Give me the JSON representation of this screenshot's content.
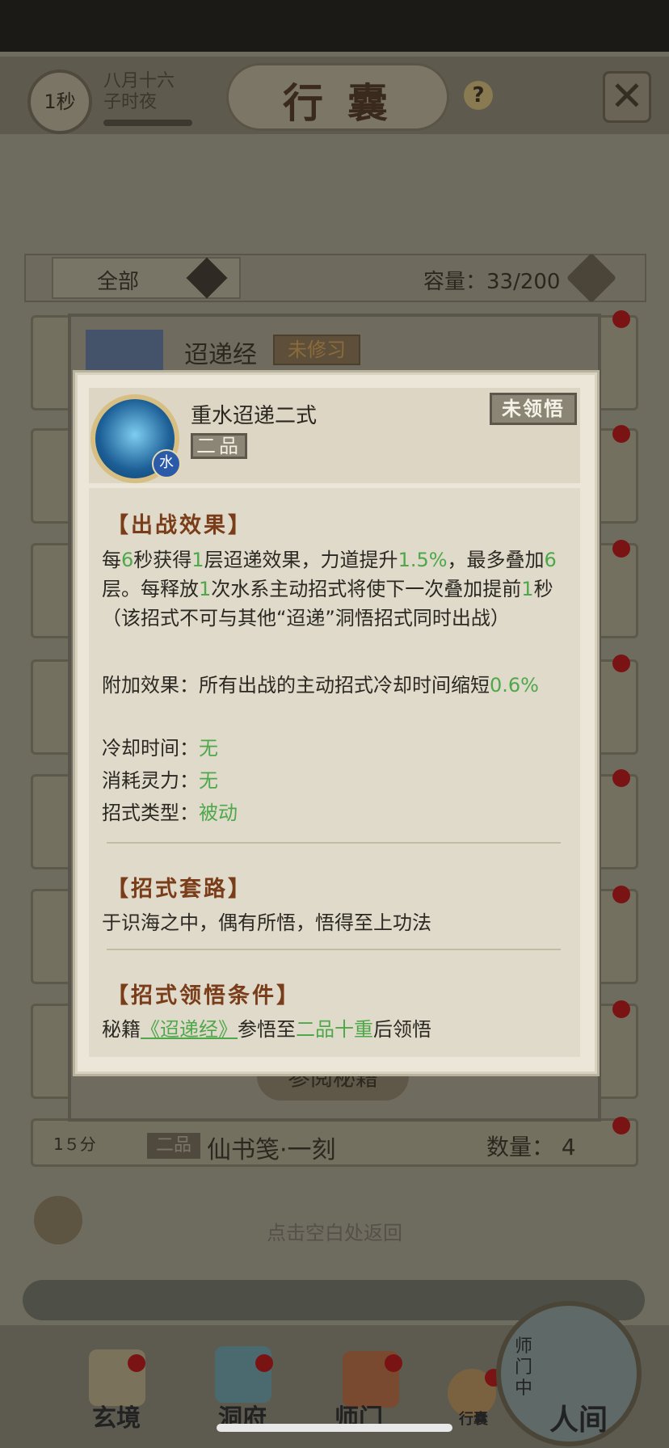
{
  "header": {
    "timer": "1秒",
    "date_line1": "八月十六",
    "date_line2": "子时夜",
    "title": "行囊",
    "help": "?",
    "close": "✕"
  },
  "filter": {
    "label": "全部",
    "capacity": "容量：33/200"
  },
  "background_list": {
    "item_name": "迢递经",
    "item_badge": "未修习",
    "button": "参阅秘籍",
    "bottom_time": "1５分",
    "bottom_grade": "二品",
    "bottom_name": "仙书笺·一刻",
    "bottom_qty": "数量： 4"
  },
  "hint": "点击空白处返回",
  "modal": {
    "skill_name": "重水迢递二式",
    "grade": "二品",
    "status": "未领悟",
    "element": "水",
    "sections": {
      "effect_title": "【出战效果】",
      "effect_p1": [
        "每",
        "6",
        "秒获得",
        "1",
        "层迢递效果，力道提升",
        "1.5%",
        "，最多叠加",
        "6",
        "层。每释放",
        "1",
        "次水系主动招式将使下一次叠加提前",
        "1",
        "秒（该招式不可与其他“迢递”洞悟招式同时出战）"
      ],
      "extra_label": "附加效果：所有出战的主动招式冷却时间缩短",
      "extra_value": "0.6%",
      "cooldown_label": "冷却时间：",
      "cooldown_value": "无",
      "cost_label": "消耗灵力：",
      "cost_value": "无",
      "type_label": "招式类型：",
      "type_value": "被动",
      "routine_title": "【招式套路】",
      "routine_text": "于识海之中，偶有所悟，悟得至上功法",
      "cond_title": "【招式领悟条件】",
      "cond_prefix": "秘籍",
      "cond_book": "《迢递经》",
      "cond_mid": "参悟至",
      "cond_level": "二品十重",
      "cond_suffix": "后领悟"
    }
  },
  "nav": {
    "items": [
      "玄境",
      "洞府",
      "师门",
      "行囊"
    ],
    "world_side": "师门中",
    "world": "人间"
  },
  "colors": {
    "accent_green": "#4ea84a",
    "section_brown": "#7a3d1a",
    "red_dot": "#7a1414"
  }
}
